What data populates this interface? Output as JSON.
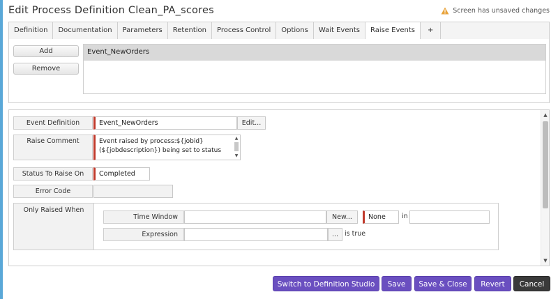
{
  "title": "Edit Process Definition Clean_PA_scores",
  "unsaved": {
    "icon": "warning-icon",
    "text": "Screen has unsaved changes"
  },
  "tabs": [
    {
      "label": "Definition",
      "active": false
    },
    {
      "label": "Documentation",
      "active": false
    },
    {
      "label": "Parameters",
      "active": false
    },
    {
      "label": "Retention",
      "active": false
    },
    {
      "label": "Process Control",
      "active": false
    },
    {
      "label": "Options",
      "active": false
    },
    {
      "label": "Wait Events",
      "active": false
    },
    {
      "label": "Raise Events",
      "active": true
    },
    {
      "label": "+",
      "active": false
    }
  ],
  "events_panel": {
    "add_label": "Add",
    "remove_label": "Remove",
    "events": [
      "Event_NewOrders"
    ]
  },
  "form": {
    "event_definition": {
      "label": "Event Definition",
      "value": "Event_NewOrders",
      "edit_label": "Edit..."
    },
    "raise_comment": {
      "label": "Raise Comment",
      "value": "Event raised by process:${jobid} (${jobdescription}) being set to status"
    },
    "status_to_raise_on": {
      "label": "Status To Raise On",
      "value": "Completed"
    },
    "error_code": {
      "label": "Error Code",
      "value": ""
    },
    "only_raised_when": {
      "label": "Only Raised When",
      "time_window_label": "Time Window",
      "time_window_value": "",
      "new_label": "New...",
      "none_value": "None",
      "in_label": "in",
      "in_value": "",
      "expression_label": "Expression",
      "expression_value": "",
      "ellipsis_label": "...",
      "is_true_label": "is true"
    }
  },
  "footer": {
    "switch_label": "Switch to Definition Studio",
    "save_label": "Save",
    "save_close_label": "Save & Close",
    "revert_label": "Revert",
    "cancel_label": "Cancel"
  },
  "colors": {
    "accent": "#6a4fc0",
    "required": "#c0392b",
    "cancel": "#3a3a3a",
    "warning": "#e8a33b"
  }
}
